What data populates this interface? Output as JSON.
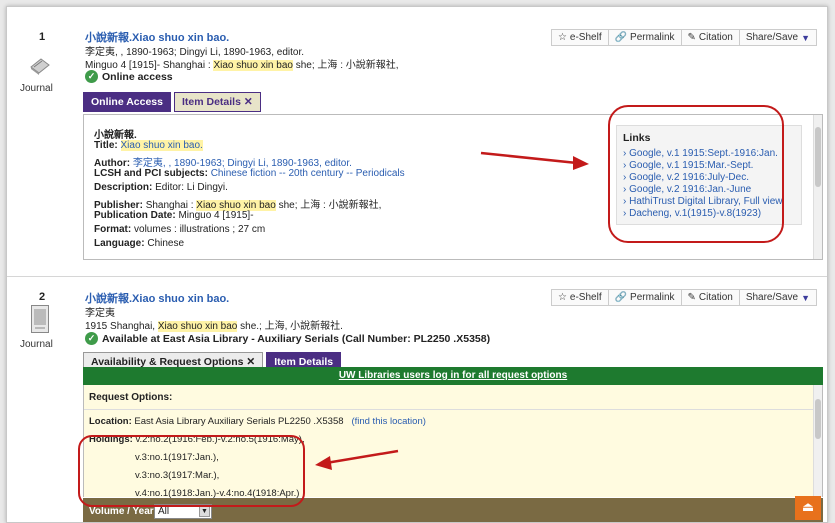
{
  "record1": {
    "number": "1",
    "type": "Journal",
    "title": "小說新報.Xiao shuo xin bao.",
    "author_line": "李定夷, , 1890-1963; Dingyi Li, 1890-1963, editor.",
    "pub_line_pre": "Minguo 4 [1915]- Shanghai : ",
    "pub_line_hl": "Xiao shuo xin bao",
    "pub_line_post": " she; 上海 : 小說新報社,",
    "availability": "Online access",
    "tabs": [
      "Online Access",
      "Item Details ✕"
    ],
    "details": {
      "cjk_title": "小說新報.",
      "title_label": "Title:",
      "title_value": "Xiao shuo xin bao.",
      "author_label": "Author:",
      "author_value": "李定夷, , 1890-1963; Dingyi Li, 1890-1963, editor.",
      "subjects_label": "LCSH and PCI subjects:",
      "subjects_value": "Chinese fiction -- 20th century -- Periodicals",
      "description_label": "Description:",
      "description_value": "Editor: Li Dingyi.",
      "publisher_label": "Publisher:",
      "publisher_pre": "Shanghai : ",
      "publisher_hl": "Xiao shuo xin bao",
      "publisher_post": " she; 上海 : 小說新報社,",
      "pubdate_label": "Publication Date:",
      "pubdate_value": "Minguo 4 [1915]-",
      "format_label": "Format:",
      "format_value": "volumes : illustrations ; 27 cm",
      "language_label": "Language:",
      "language_value": "Chinese"
    },
    "links": {
      "heading": "Links",
      "items": [
        "Google, v.1 1915:Sept.-1916:Jan.",
        "Google, v.1 1915:Mar.-Sept.",
        "Google, v.2 1916:July-Dec.",
        "Google, v.2 1916:Jan.-June",
        "HathiTrust Digital Library, Full view",
        "Dacheng, v.1(1915)-v.8(1923)"
      ]
    }
  },
  "record2": {
    "number": "2",
    "type": "Journal",
    "title": "小說新報.Xiao shuo xin bao.",
    "author_line": "李定夷",
    "pub_line_pre": "1915 Shanghai, ",
    "pub_line_hl": "Xiao shuo xin bao",
    "pub_line_post": " she.; 上海, 小說新報社.",
    "availability": "Available at East Asia Library - Auxiliary Serials (Call Number: PL2250 .X5358)",
    "tabs": [
      "Availability & Request Options ✕",
      "Item Details"
    ],
    "login_banner": "UW Libraries users log in for all request options",
    "request_heading": "Request Options:",
    "location_label": "Location:",
    "location_value": "East Asia Library  Auxiliary Serials  PL2250 .X5358",
    "location_link": "(find this location)",
    "holdings_label": "Holdings:",
    "holdings": [
      "v.2:no.2(1916:Feb.)-v.2:no.5(1916:May),",
      "v.3:no.1(1917:Jan.),",
      "v.3:no.3(1917:Mar.),",
      "v.4:no.1(1918:Jan.)-v.4:no.4(1918:Apr.)"
    ],
    "volume_year_label": "Volume / Year:",
    "volume_year_value": "All"
  },
  "actions": {
    "eshelf": "e-Shelf",
    "permalink": "Permalink",
    "citation": "Citation",
    "share": "Share/Save"
  },
  "annotation_color": "#c31a1a"
}
